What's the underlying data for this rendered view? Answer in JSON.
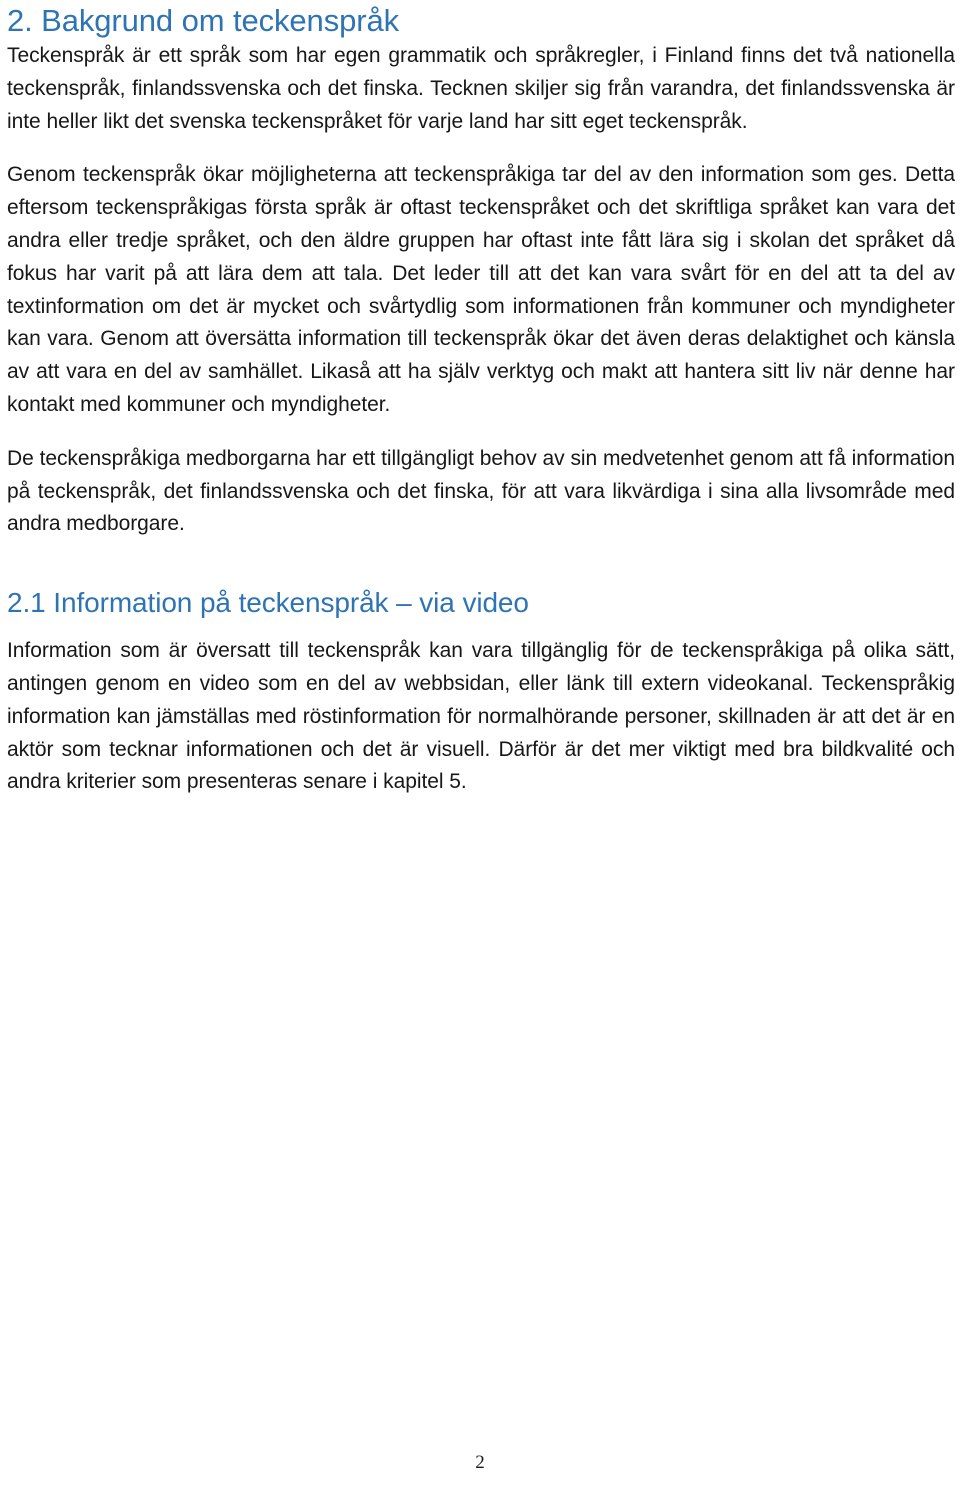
{
  "document": {
    "heading1": "2. Bakgrund om teckenspråk",
    "heading2": "2.1 Information på teckenspråk – via video",
    "paragraphs": {
      "p1": "Teckenspråk är ett språk som har egen grammatik och språkregler, i Finland finns det två nationella teckenspråk, finlandssvenska och det finska. Tecknen skiljer sig från varandra, det finlandssvenska är inte heller likt det svenska teckenspråket för varje land har sitt eget teckenspråk.",
      "p2": "Genom teckenspråk ökar möjligheterna att teckenspråkiga tar del av den information som ges. Detta eftersom teckenspråkigas första språk är oftast teckenspråket och det skriftliga språket kan vara det andra eller tredje språket, och den äldre gruppen har oftast inte fått lära sig i skolan det språket då fokus har varit på att lära dem att tala. Det leder till att det kan vara svårt för en del att ta del av textinformation om det är mycket och svårtydlig som informationen från kommuner och myndigheter kan vara. Genom att översätta information till teckenspråk ökar det även deras delaktighet och känsla av att vara en del av samhället. Likaså att ha själv verktyg och makt att hantera sitt liv när denne har kontakt med kommuner och myndigheter.",
      "p3": "De teckenspråkiga medborgarna har ett tillgängligt behov av sin medvetenhet genom att få information på teckenspråk, det finlandssvenska och det finska, för att vara likvärdiga i sina alla livsområde med andra medborgare.",
      "p4": "Information som är översatt till teckenspråk kan vara tillgänglig för de teckenspråkiga på olika sätt, antingen genom en video som en del av webbsidan, eller länk till extern videokanal. Teckenspråkig information kan jämställas med röstinformation för normalhörande personer, skillnaden är att det är en aktör som tecknar informationen och det är visuell. Därför är det mer viktigt med bra bildkvalité och andra kriterier som presenteras senare i kapitel 5."
    },
    "page_number": "2",
    "colors": {
      "heading": "#2E74B5",
      "body_text": "#171717",
      "background": "#ffffff"
    }
  }
}
